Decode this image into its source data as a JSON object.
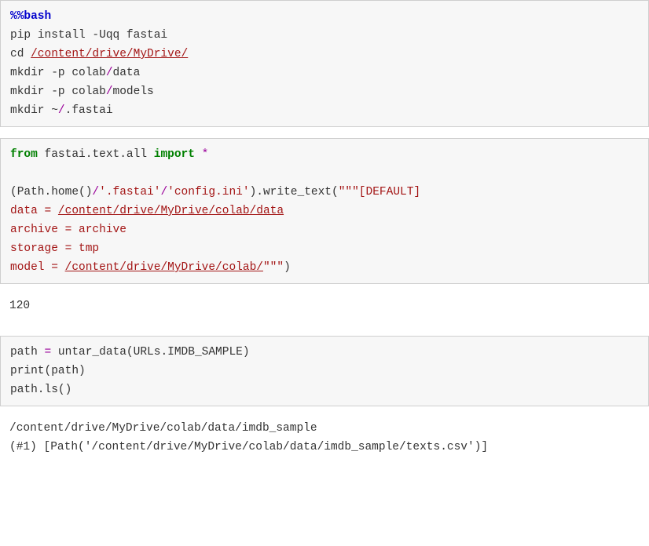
{
  "cell1": {
    "l1a": "%%bash",
    "l2a": "pip install -Uqq fastai",
    "l3a": "cd ",
    "l3b": "/content/drive/MyDrive/",
    "l4a": "mkdir -p colab",
    "l4b": "/",
    "l4c": "data",
    "l5a": "mkdir -p colab",
    "l5b": "/",
    "l5c": "models",
    "l6a": "mkdir ~",
    "l6b": "/",
    "l6c": ".fastai"
  },
  "cell2": {
    "l1a": "from",
    "l1b": " fastai.text.all ",
    "l1c": "import",
    "l1d": " ",
    "l1e": "*",
    "l2_blank": "",
    "l3a": "(Path.home()",
    "l3b": "/",
    "l3c": "'.fastai'",
    "l3d": "/",
    "l3e": "'config.ini'",
    "l3f": ").write_text(",
    "l3g": "\"\"\"[DEFAULT]",
    "l4a": "data = ",
    "l4b": "/content/drive/MyDrive/colab/data",
    "l5a": "archive = archive",
    "l6a": "storage = tmp",
    "l7a": "model = ",
    "l7b": "/content/drive/MyDrive/colab/",
    "l7c": "\"\"\"",
    "l7d": ")"
  },
  "out2": {
    "l1": "120"
  },
  "cell3": {
    "l1a": "path ",
    "l1b": "=",
    "l1c": " untar_data(URLs.IMDB_SAMPLE)",
    "l2a": "print(path)",
    "l3a": "path.ls()"
  },
  "out3": {
    "l1": "/content/drive/MyDrive/colab/data/imdb_sample",
    "l2": "(#1) [Path('/content/drive/MyDrive/colab/data/imdb_sample/texts.csv')]"
  }
}
